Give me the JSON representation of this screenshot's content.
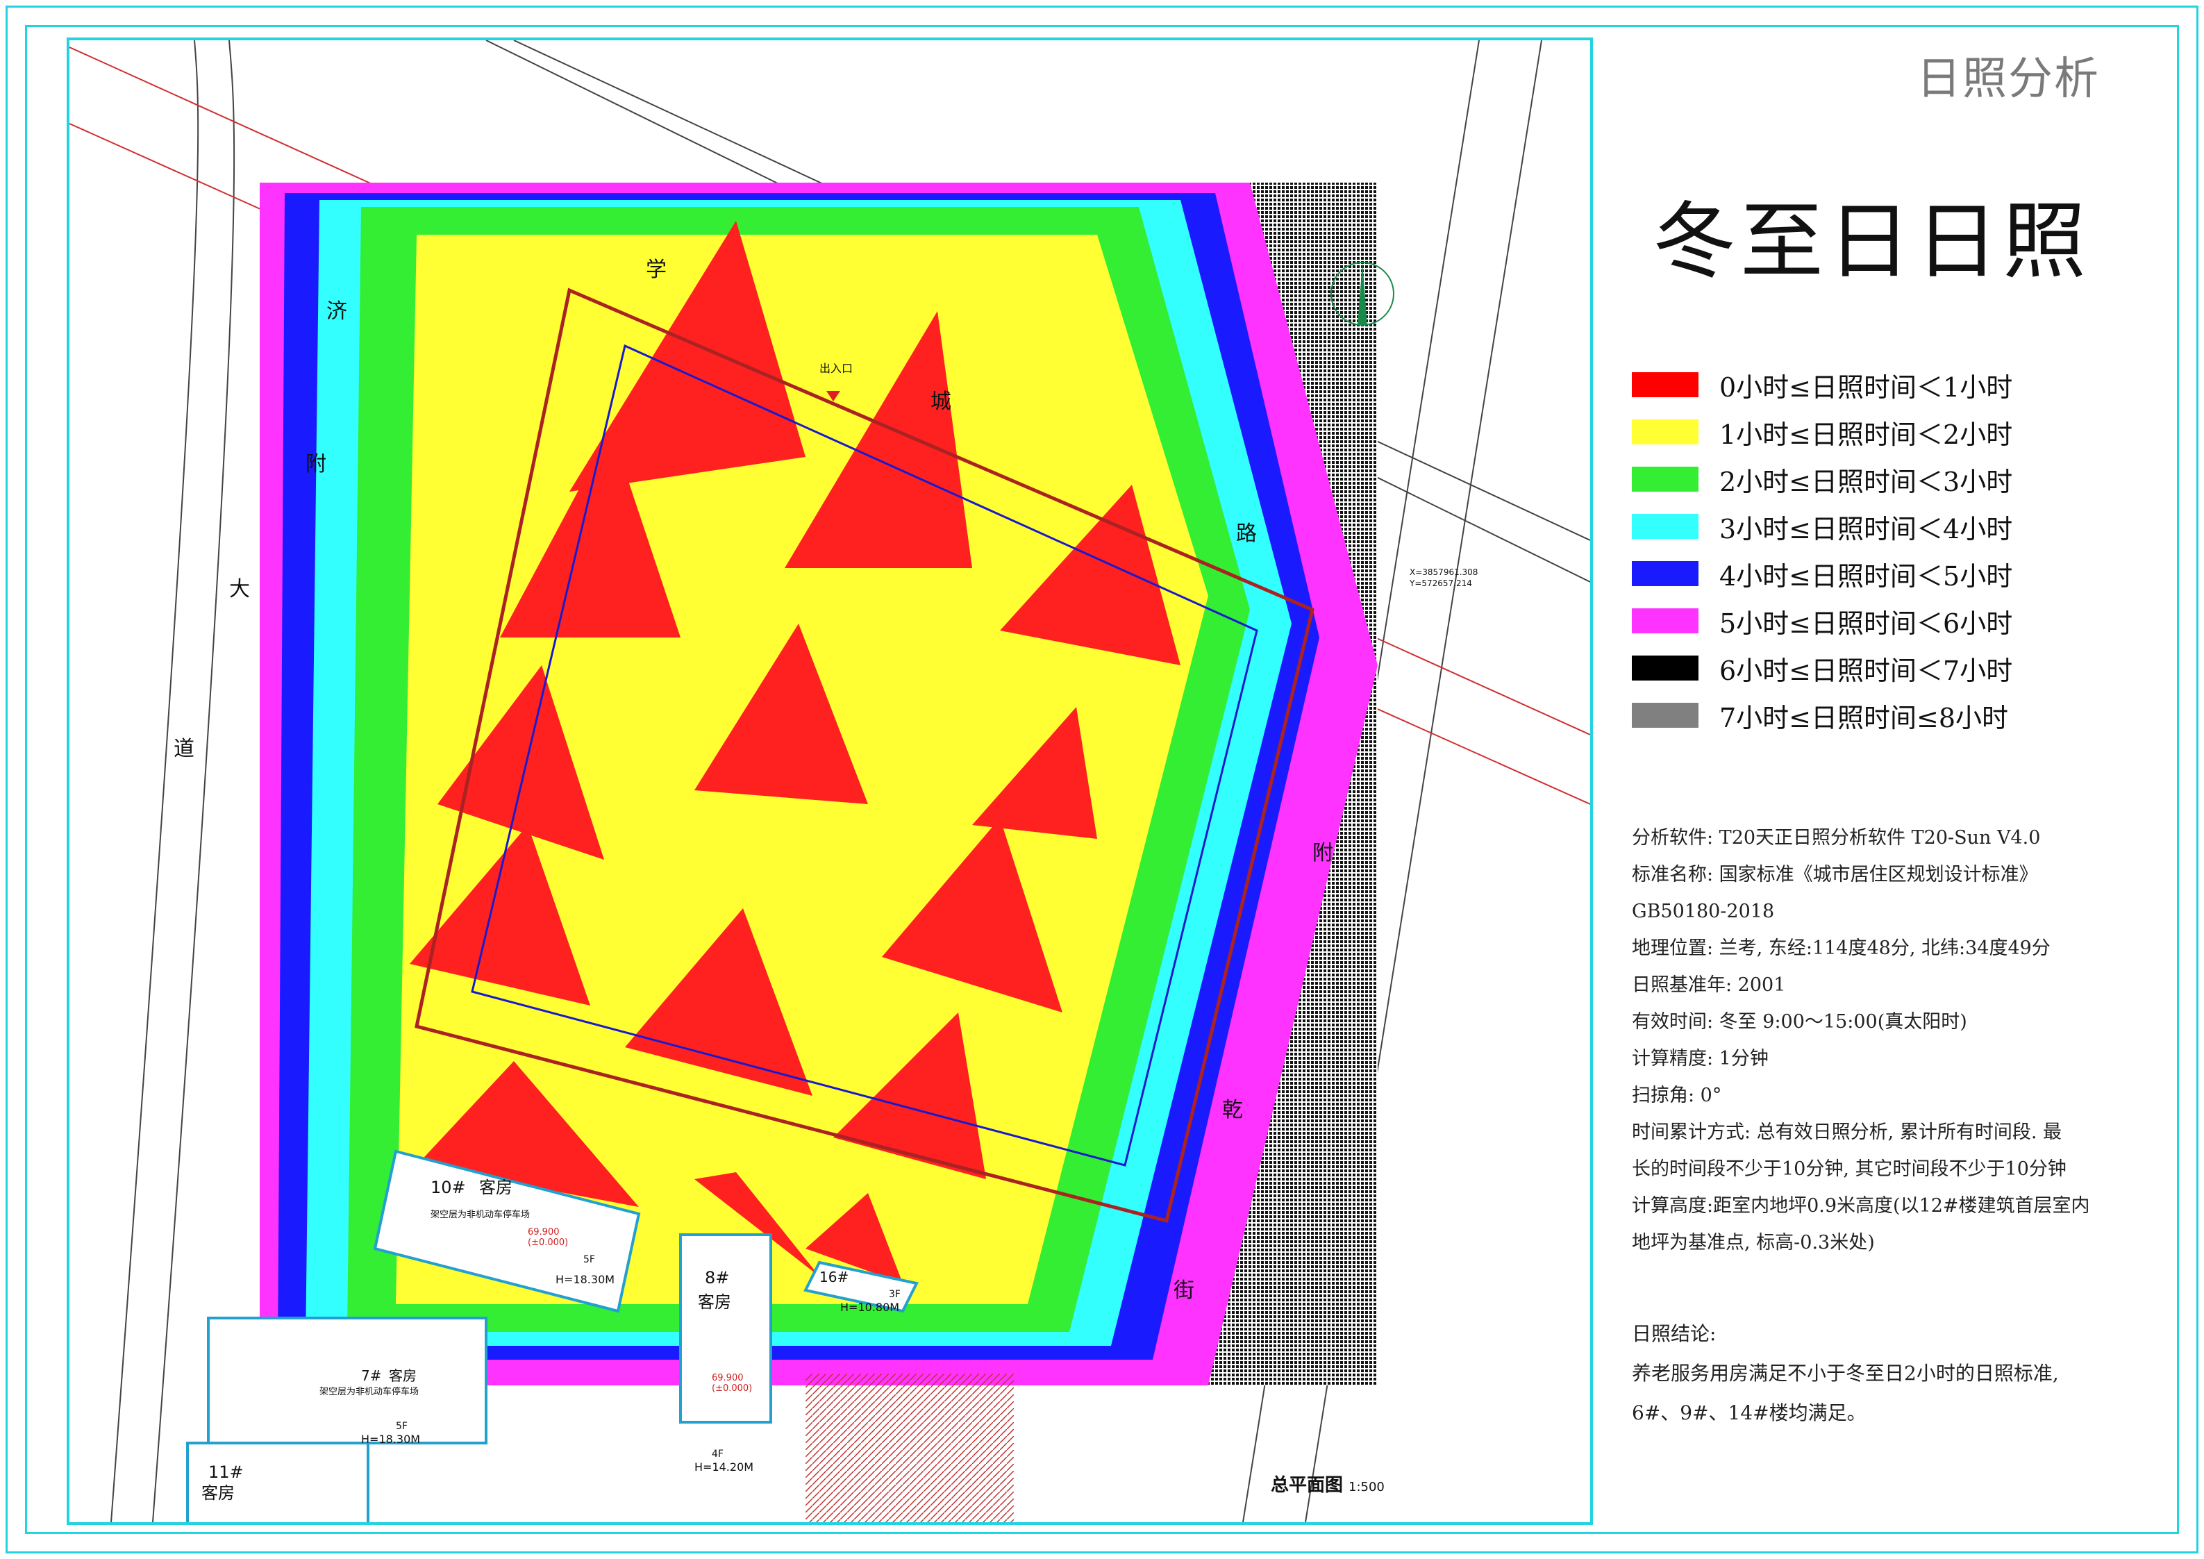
{
  "header": {
    "title": "日照分析"
  },
  "main_title": "冬至日日照",
  "legend": [
    {
      "color": "#ff0000",
      "label": "0小时≤日照时间＜1小时"
    },
    {
      "color": "#ffff33",
      "label": "1小时≤日照时间＜2小时"
    },
    {
      "color": "#33ee33",
      "label": "2小时≤日照时间＜3小时"
    },
    {
      "color": "#33ffff",
      "label": "3小时≤日照时间＜4小时"
    },
    {
      "color": "#1a1aff",
      "label": "4小时≤日照时间＜5小时"
    },
    {
      "color": "#ff33ff",
      "label": "5小时≤日照时间＜6小时"
    },
    {
      "color": "#000000",
      "label": "6小时≤日照时间＜7小时"
    },
    {
      "color": "#808080",
      "label": "7小时≤日照时间≤8小时"
    }
  ],
  "info": {
    "software": "分析软件: T20天正日照分析软件 T20-Sun V4.0",
    "standard": "标准名称: 国家标准《城市居住区规划设计标准》",
    "standard_code": "GB50180-2018",
    "location": "地理位置: 兰考, 东经:114度48分, 北纬:34度49分",
    "base_year": "日照基准年: 2001",
    "valid_time": "有效时间:  冬至 9:00～15:00(真太阳时)",
    "precision": "计算精度: 1分钟",
    "sweep_angle": "扫掠角: 0°",
    "accumulation_1": "时间累计方式: 总有效日照分析, 累计所有时间段. 最",
    "accumulation_2": "长的时间段不少于10分钟, 其它时间段不少于10分钟",
    "height_1": "计算高度:距室内地坪0.9米高度(以12#楼建筑首层室内",
    "height_2": "地坪为基准点, 标高-0.3米处)"
  },
  "conclusion": {
    "title": "日照结论:",
    "line1": "养老服务用房满足不小于冬至日2小时的日照标准,",
    "line2": "6#、9#、14#楼均满足。"
  },
  "map": {
    "roads": {
      "left_road_1": "大",
      "left_road_2": "道",
      "top_1": "学",
      "top_2": "城",
      "left_top_1": "济",
      "left_top_2": "附",
      "right_1": "路",
      "right_2": "附",
      "right_3": "乾",
      "right_4": "街"
    },
    "entrance": "出入口",
    "coord_x": "X=3857961.308",
    "coord_y": "Y=572657.214",
    "buildings": {
      "b10": {
        "name": "10#",
        "type": "客房",
        "floors": "5F",
        "height": "H=18.30M",
        "note": "架空层为非机动车停车场",
        "elev": "69.900",
        "elev_sub": "(±0.000)"
      },
      "b8": {
        "name": "8#",
        "type": "客房",
        "floors": "4F",
        "height": "H=14.20M",
        "elev": "69.900",
        "elev_sub": "(±0.000)"
      },
      "b16": {
        "name": "16#",
        "floors": "3F",
        "height": "H=10.80M"
      },
      "b7": {
        "name": "7#",
        "type": "客房",
        "floors": "5F",
        "height": "H=18.30M",
        "note": "架空层为非机动车停车场"
      },
      "b11": {
        "name": "11#",
        "type": "客房"
      }
    },
    "scale_title": "总平面图",
    "scale_ratio": "1:500"
  }
}
